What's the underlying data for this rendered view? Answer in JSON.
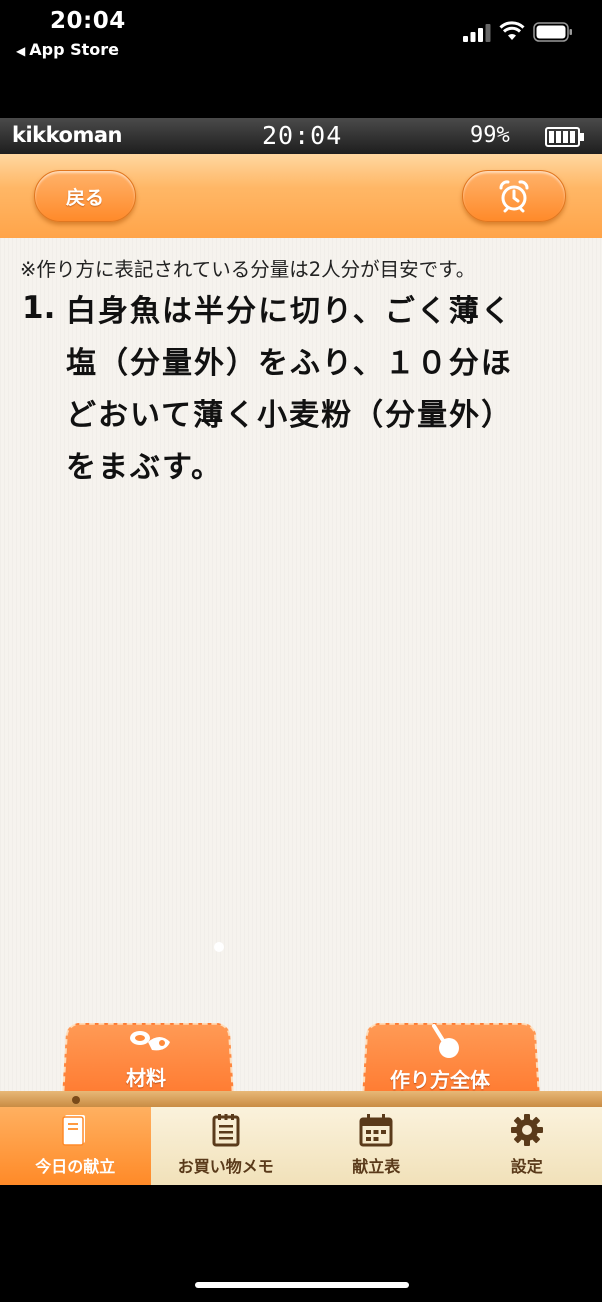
{
  "ios_status": {
    "time": "20:04",
    "back_label": "App Store"
  },
  "device_bar": {
    "brand": "kikkoman",
    "time": "20:04",
    "battery": "99%"
  },
  "header": {
    "back_label": "戻る",
    "alarm_icon": "alarm-clock-icon"
  },
  "content": {
    "note": "※作り方に表記されている分量は2人分が目安です。",
    "step_number": "1.",
    "step_lines": [
      "白身魚は半分に切り、ごく薄く",
      "塩（分量外）をふり、１０分ほ",
      "どおいて薄く小麦粉（分量外）",
      "をまぶす。"
    ]
  },
  "bottom_tabs": {
    "ingredients_label": "材料",
    "all_steps_label": "作り方全体"
  },
  "nav": {
    "items": [
      {
        "label": "今日の献立",
        "icon": "book-icon",
        "active": true
      },
      {
        "label": "お買い物メモ",
        "icon": "notepad-icon",
        "active": false
      },
      {
        "label": "献立表",
        "icon": "calendar-icon",
        "active": false
      },
      {
        "label": "設定",
        "icon": "gear-icon",
        "active": false
      }
    ]
  },
  "colors": {
    "accent_orange": "#ff8a2a",
    "nav_text": "#5a3a1a"
  }
}
